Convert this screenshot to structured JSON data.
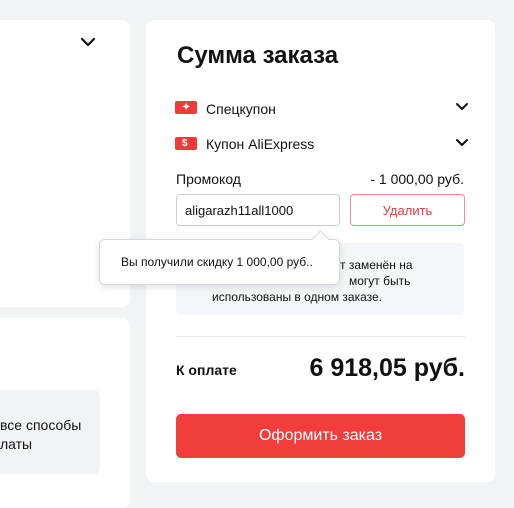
{
  "order_summary": {
    "title": "Сумма заказа",
    "special_coupon_label": "Спецкупон",
    "aliexpress_coupon_label": "Купон AliExpress",
    "promo_label": "Промокод",
    "promo_discount": "- 1 000,00 руб.",
    "promo_value": "aligarazh11all1000",
    "delete_label": "Удалить",
    "info_line1_suffix": "т заменён на",
    "info_line2_suffix": "могут быть",
    "info_line3": "использованы в одном заказе.",
    "tooltip_text": "Вы получили скидку 1 000,00 руб..",
    "pay_label": "К оплате",
    "pay_total": "6 918,05 руб.",
    "checkout_label": "Оформить заказ"
  },
  "left_panel": {
    "payment_line1": "все способы",
    "payment_line2": "латы"
  },
  "colors": {
    "accent": "#f23d3d",
    "background": "#f2f3f5",
    "info_box": "#f4f6fa"
  },
  "icons": {
    "special_coupon": "special-coupon-icon",
    "aliexpress_coupon": "aliexpress-coupon-icon",
    "chevron": "chevron-down-icon"
  }
}
